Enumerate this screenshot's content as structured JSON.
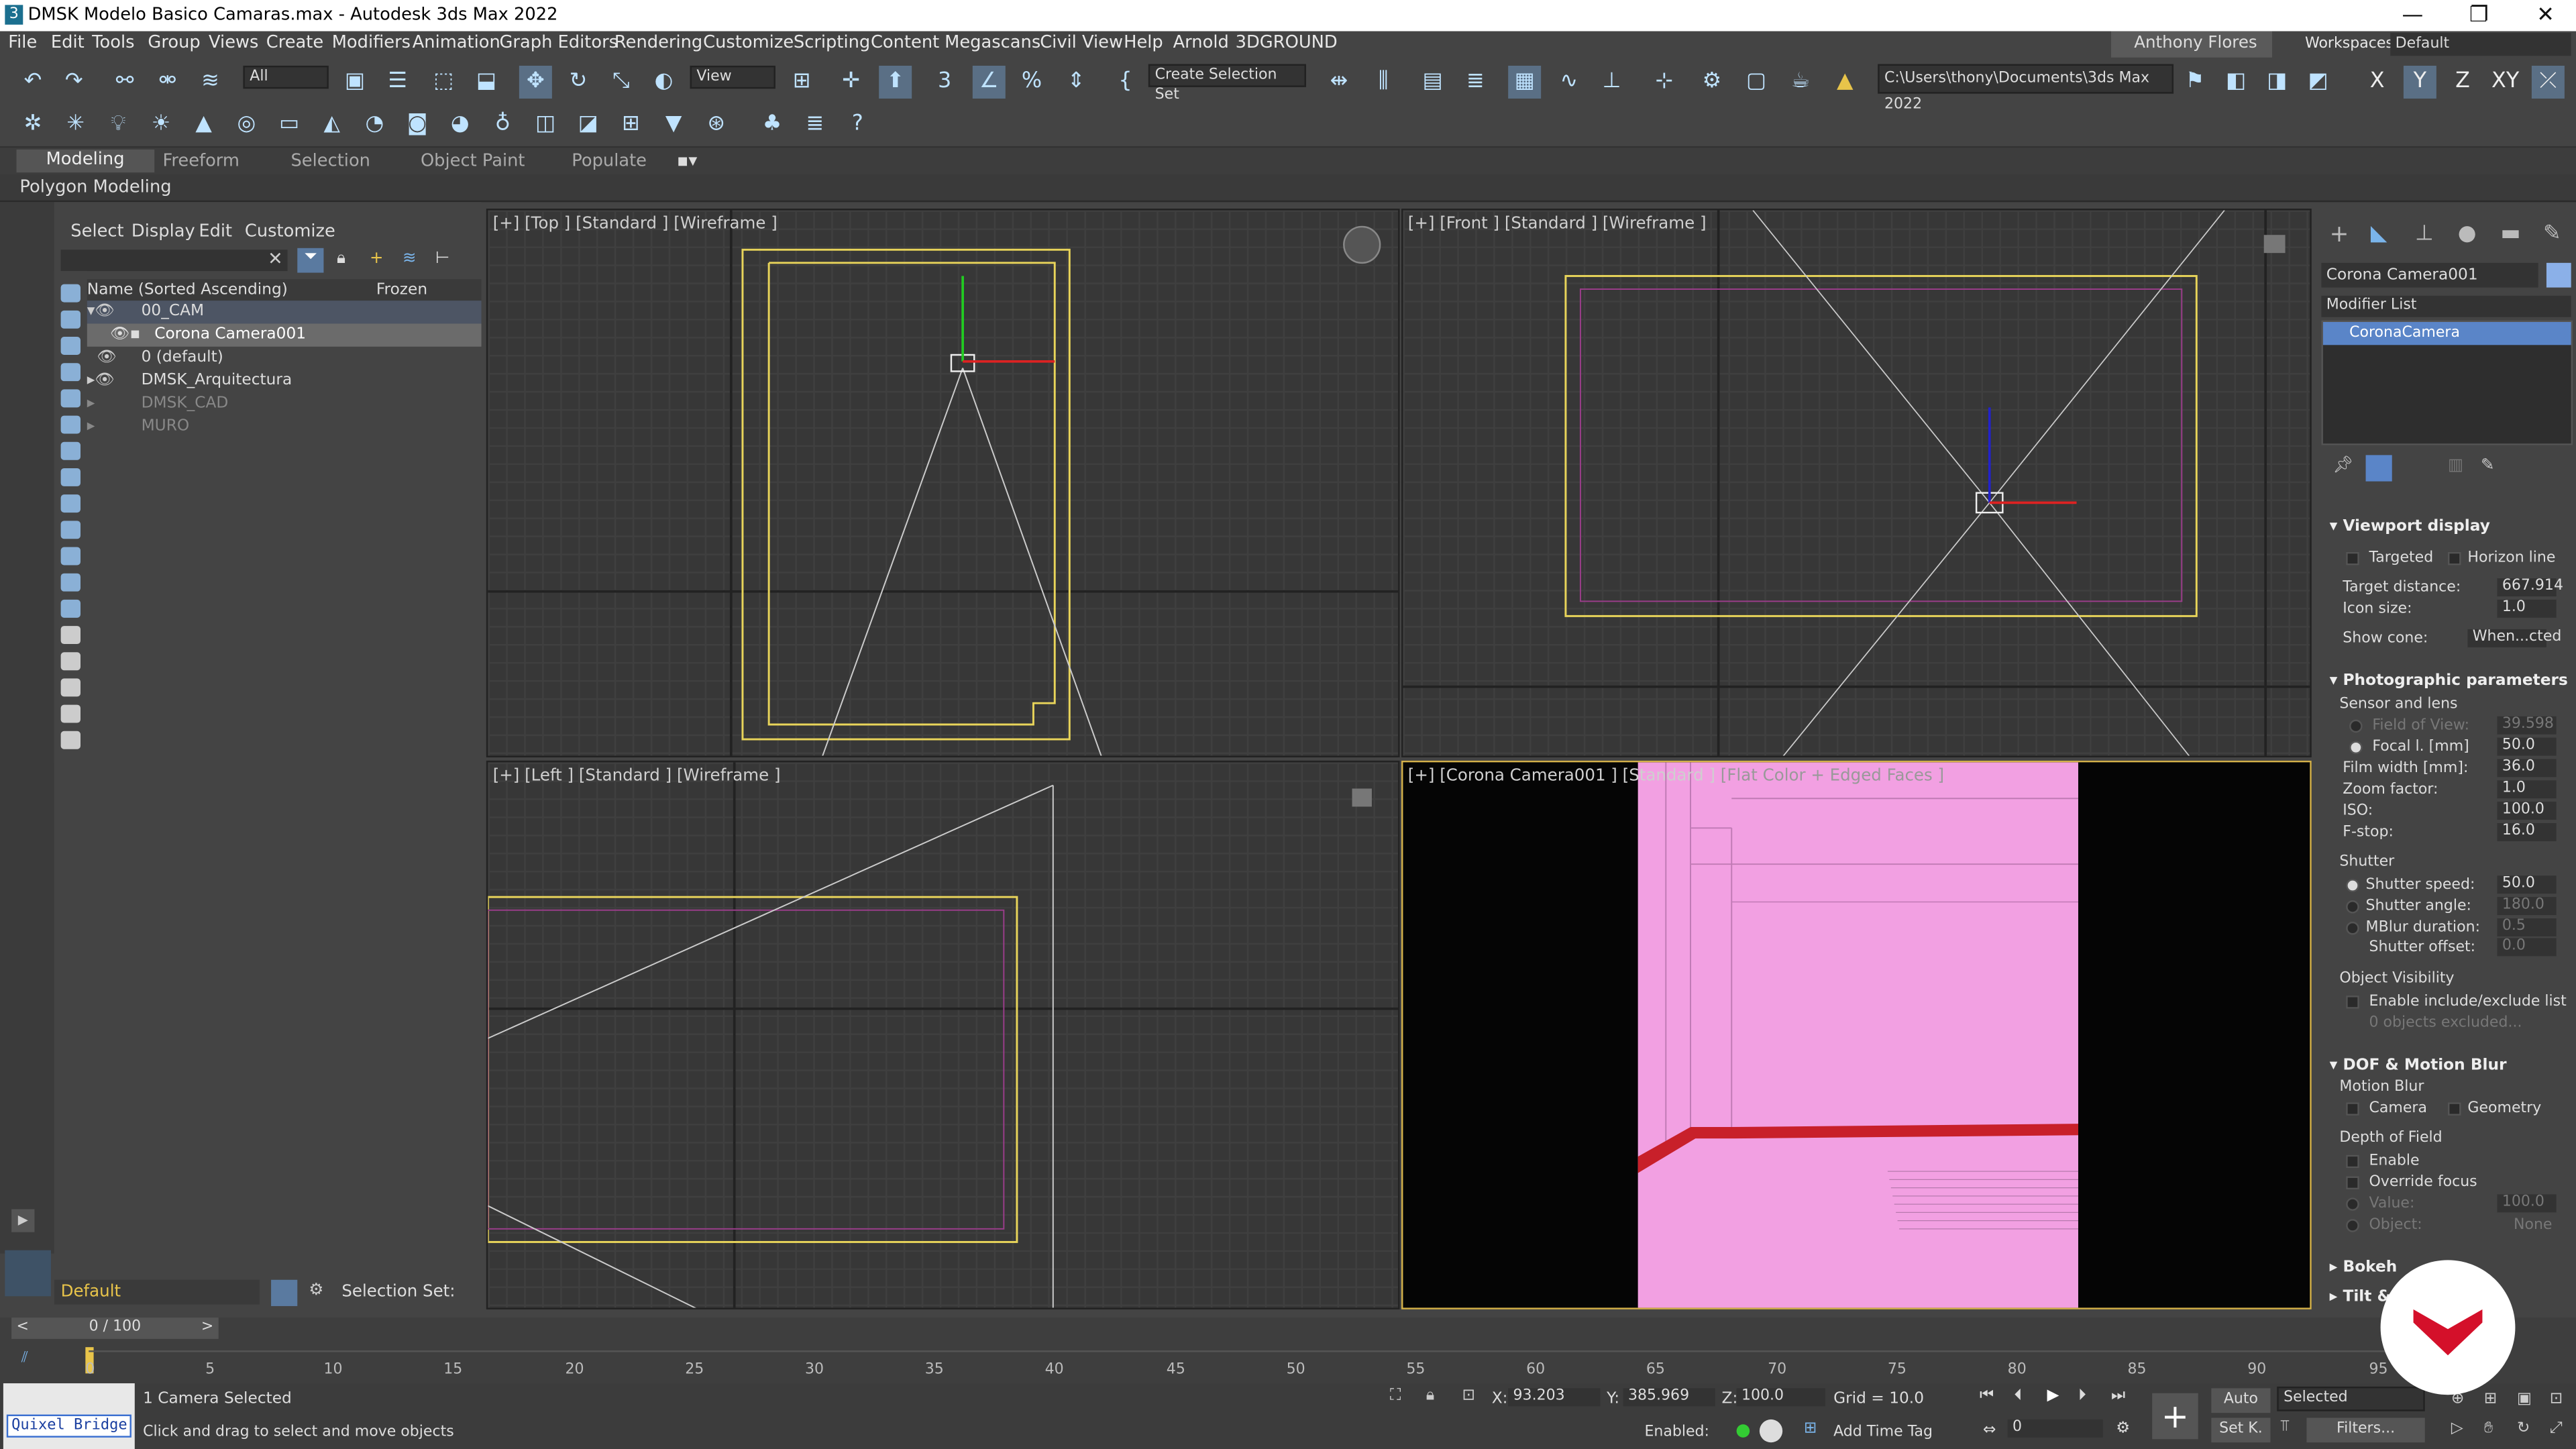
{
  "window": {
    "title": "DMSK Modelo Basico Camaras.max - Autodesk 3ds Max 2022"
  },
  "menu": [
    "File",
    "Edit",
    "Tools",
    "Group",
    "Views",
    "Create",
    "Modifiers",
    "Animation",
    "Graph Editors",
    "Rendering",
    "Customize",
    "Scripting",
    "Content",
    "Megascans",
    "Civil View",
    "Help",
    "Arnold",
    "3DGROUND"
  ],
  "user": {
    "name": "Anthony Flores",
    "workspaces_label": "Workspaces:",
    "workspace": "Default"
  },
  "toolbar": {
    "filter": "All",
    "view": "View",
    "selection_set": "Create Selection Set",
    "path": "C:\\Users\\thony\\Documents\\3ds Max 2022",
    "axes": [
      "X",
      "Y",
      "Z",
      "XY"
    ]
  },
  "ribbon": {
    "tabs": [
      "Modeling",
      "Freeform",
      "Selection",
      "Object Paint",
      "Populate"
    ],
    "sub": "Polygon Modeling"
  },
  "scene": {
    "menu": [
      "Select",
      "Display",
      "Edit",
      "Customize"
    ],
    "col_name": "Name (Sorted Ascending)",
    "col_frozen": "Frozen",
    "rows": [
      "00_CAM",
      "Corona Camera001",
      "0 (default)",
      "DMSK_Arquitectura",
      "DMSK_CAD",
      "MURO"
    ],
    "layer": "Default",
    "selection_set_label": "Selection Set:"
  },
  "viewports": {
    "top": "[+] [Top ] [Standard ] [Wireframe ]",
    "front": "[+] [Front ] [Standard ] [Wireframe ]",
    "left": "[+] [Left ] [Standard ] [Wireframe ]",
    "cam_a": "[+] [Corona Camera001 ]  [Standard ]",
    "cam_b": "[Flat Color + Edged Faces ]"
  },
  "panel": {
    "object_name": "Corona Camera001",
    "modifier_list": "Modifier List",
    "stack_item": "CoronaCamera",
    "viewport_display": "Viewport display",
    "targeted": "Targeted",
    "horizon": "Horizon line",
    "target_distance_label": "Target distance:",
    "target_distance": "667.914",
    "icon_size_label": "Icon size:",
    "icon_size": "1.0",
    "show_cone_label": "Show cone:",
    "show_cone": "When...cted",
    "photo": "Photographic parameters",
    "sensor": "Sensor and lens",
    "fov_label": "Field of View:",
    "fov": "39.598",
    "focal_label": "Focal l. [mm]",
    "focal": "50.0",
    "film_label": "Film width [mm]:",
    "film": "36.0",
    "zoom_label": "Zoom factor:",
    "zoom": "1.0",
    "iso_label": "ISO:",
    "iso": "100.0",
    "fstop_label": "F-stop:",
    "fstop": "16.0",
    "shutter": "Shutter",
    "shutter_speed_label": "Shutter speed:",
    "shutter_speed": "50.0",
    "shutter_angle_label": "Shutter angle:",
    "shutter_angle": "180.0",
    "mblur_label": "MBlur duration:",
    "mblur": "0.5",
    "offset_label": "Shutter offset:",
    "offset": "0.0",
    "visibility": "Object Visibility",
    "include": "Enable include/exclude list",
    "excluded": "0 objects excluded...",
    "dof": "DOF & Motion Blur",
    "motion_blur": "Motion Blur",
    "camera": "Camera",
    "geometry": "Geometry",
    "depth": "Depth of Field",
    "enable": "Enable",
    "override": "Override focus",
    "value_label": "Value:",
    "value": "100.0",
    "object_label": "Object:",
    "object": "None",
    "bokeh": "Bokeh",
    "tilt": "Tilt &"
  },
  "timeline": {
    "counter": "0 / 100",
    "ticks": [
      "0",
      "5",
      "10",
      "15",
      "20",
      "25",
      "30",
      "35",
      "40",
      "45",
      "50",
      "55",
      "60",
      "65",
      "70",
      "75",
      "80",
      "85",
      "90",
      "95"
    ]
  },
  "status": {
    "quixel": "Quixel Bridge",
    "selected": "1 Camera Selected",
    "hint": "Click and drag to select and move objects",
    "x": "93.203",
    "y": "385.969",
    "z": "100.0",
    "grid": "Grid = 10.0",
    "enabled": "Enabled:",
    "add_time_tag": "Add Time Tag",
    "auto": "Auto",
    "selected_mode": "Selected",
    "set_key": "Set K.",
    "filters": "Filters...",
    "frame": "0"
  }
}
